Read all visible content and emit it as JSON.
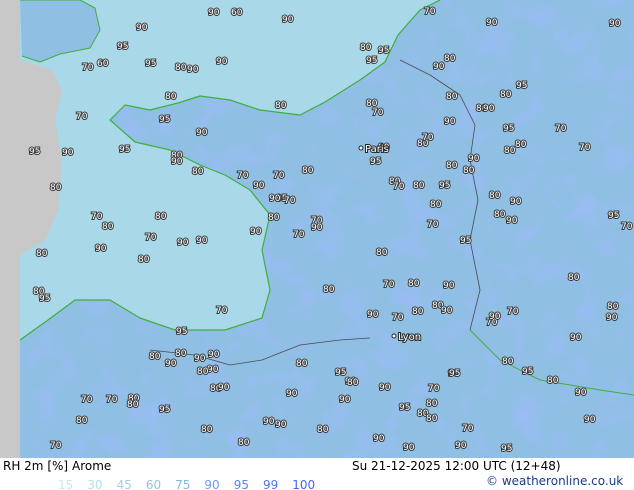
{
  "header": {
    "variable": "RH 2m [%]",
    "model": "Arome",
    "valid_time": "Su 21-12-2025 12:00 UTC (12+48)",
    "credit": "© weatheronline.co.uk"
  },
  "legend": {
    "values": [
      "15",
      "30",
      "45",
      "60",
      "75",
      "90",
      "95",
      "99",
      "100"
    ],
    "colors": [
      "#c6e8f2",
      "#b4dcea",
      "#a2d0e4",
      "#90c4e0",
      "#84b6e8",
      "#6d9af0",
      "#5a86f2",
      "#4d76ee",
      "#4068e8"
    ]
  },
  "colors": {
    "land_low": "#8fbfe3",
    "land_high": "#6f9ff2",
    "sea": "#a9d8e8",
    "coast": "#3fae3f",
    "contour": "#8a8a8a",
    "outside_domain": "#c8c8c8"
  },
  "map": {
    "cities": [
      "Paris",
      "Lyon"
    ],
    "contour_labels": [
      "80",
      "90",
      "80",
      "80",
      "90",
      "90",
      "80",
      "70",
      "80",
      "80",
      "70",
      "80",
      "80",
      "90",
      "95",
      "95",
      "95",
      "90",
      "95",
      "80",
      "90",
      "80",
      "90",
      "80",
      "95",
      "95",
      "90",
      "90",
      "90",
      "90",
      "80",
      "70",
      "90",
      "80",
      "90",
      "80",
      "70",
      "80",
      "70",
      "70",
      "80",
      "70",
      "80",
      "80",
      "80",
      "70",
      "90",
      "70",
      "80",
      "70",
      "90",
      "80",
      "70",
      "80",
      "80",
      "90",
      "90",
      "95",
      "95",
      "95",
      "90",
      "90",
      "90",
      "80",
      "70",
      "80",
      "90",
      "80",
      "80",
      "70",
      "70",
      "80",
      "90",
      "90",
      "95",
      "80",
      "70",
      "70",
      "60",
      "80",
      "70",
      "60",
      "70",
      "80",
      "80",
      "70",
      "70",
      "80",
      "95",
      "90",
      "95",
      "90",
      "90",
      "95",
      "90",
      "90",
      "90",
      "80",
      "80",
      "90",
      "95",
      "70",
      "80",
      "90",
      "70",
      "70",
      "80",
      "90",
      "90",
      "70",
      "80",
      "80",
      "90",
      "80",
      "80",
      "90",
      "70",
      "80",
      "90",
      "95",
      "80",
      "70",
      "90",
      "95",
      "95",
      "95",
      "90",
      "90",
      "80",
      "95",
      "90",
      "95",
      "90",
      "90",
      "90",
      "95",
      "90",
      "80",
      "80",
      "95",
      "90",
      "80",
      "90",
      "80",
      "80",
      "70",
      "80",
      "80",
      "80",
      "80",
      "80"
    ]
  }
}
